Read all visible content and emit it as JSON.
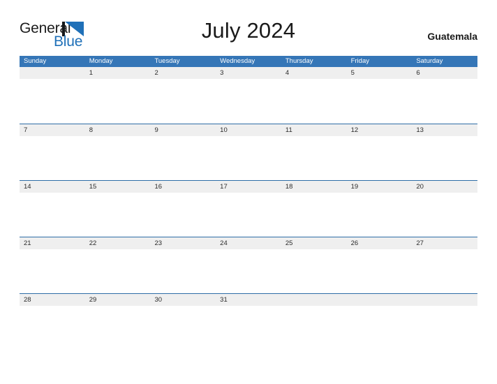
{
  "logo": {
    "word_top": "General",
    "word_bottom": "Blue",
    "mark": "flag-triangle-icon",
    "color_blue": "#1f70b8",
    "color_dark": "#16191c"
  },
  "header": {
    "title": "July 2024",
    "location": "Guatemala"
  },
  "colors": {
    "header_blue": "#3576b7",
    "row_line_blue": "#2e6da6",
    "day_band_gray": "#efefef",
    "page_background": "#ffffff",
    "text_dark": "#1a1a1a"
  },
  "calendar": {
    "month": "July",
    "year": "2024",
    "weekday_headers": [
      "Sunday",
      "Monday",
      "Tuesday",
      "Wednesday",
      "Thursday",
      "Friday",
      "Saturday"
    ],
    "weeks": [
      {
        "days": [
          "",
          "1",
          "2",
          "3",
          "4",
          "5",
          "6"
        ]
      },
      {
        "days": [
          "7",
          "8",
          "9",
          "10",
          "11",
          "12",
          "13"
        ]
      },
      {
        "days": [
          "14",
          "15",
          "16",
          "17",
          "18",
          "19",
          "20"
        ]
      },
      {
        "days": [
          "21",
          "22",
          "23",
          "24",
          "25",
          "26",
          "27"
        ]
      },
      {
        "days": [
          "28",
          "29",
          "30",
          "31",
          "",
          "",
          ""
        ]
      }
    ]
  }
}
